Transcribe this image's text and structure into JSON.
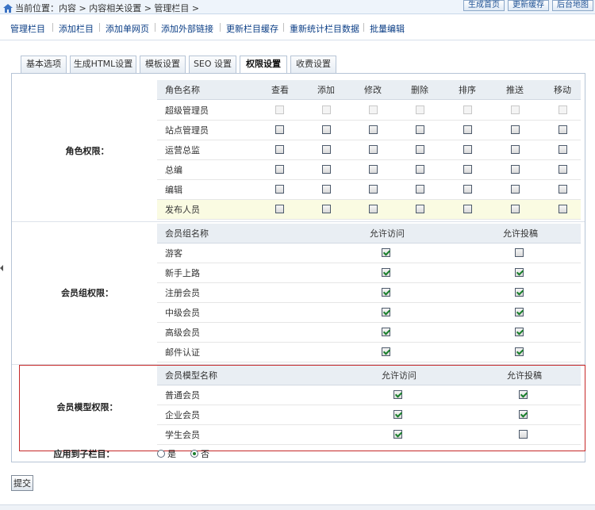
{
  "breadcrumb": {
    "text": "当前位置：内容 > 内容相关设置 > 管理栏目 >"
  },
  "top_buttons": [
    "生成首页",
    "更新缓存",
    "后台地图"
  ],
  "nav": [
    "管理栏目",
    "添加栏目",
    "添加单网页",
    "添加外部链接",
    "更新栏目缓存",
    "重新统计栏目数据",
    "批量编辑"
  ],
  "tabs": [
    "基本选项",
    "生成HTML设置",
    "模板设置",
    "SEO 设置",
    "权限设置",
    "收费设置"
  ],
  "active_tab": "权限设置",
  "role_section": {
    "label": "角色权限：",
    "headers": [
      "角色名称",
      "查看",
      "添加",
      "修改",
      "删除",
      "排序",
      "推送",
      "移动"
    ],
    "rows": [
      {
        "name": "超级管理员",
        "disabled": true
      },
      {
        "name": "站点管理员",
        "disabled": false
      },
      {
        "name": "运营总监",
        "disabled": false
      },
      {
        "name": "总编",
        "disabled": false
      },
      {
        "name": "编辑",
        "disabled": false
      },
      {
        "name": "发布人员",
        "disabled": false
      }
    ]
  },
  "group_section": {
    "label": "会员组权限：",
    "headers": [
      "会员组名称",
      "允许访问",
      "允许投稿"
    ],
    "rows": [
      {
        "name": "游客",
        "visit": true,
        "submit": false
      },
      {
        "name": "新手上路",
        "visit": true,
        "submit": true
      },
      {
        "name": "注册会员",
        "visit": true,
        "submit": true
      },
      {
        "name": "中级会员",
        "visit": true,
        "submit": true
      },
      {
        "name": "高级会员",
        "visit": true,
        "submit": true
      },
      {
        "name": "邮件认证",
        "visit": true,
        "submit": true
      }
    ]
  },
  "model_section": {
    "label": "会员模型权限：",
    "headers": [
      "会员模型名称",
      "允许访问",
      "允许投稿"
    ],
    "rows": [
      {
        "name": "普通会员",
        "visit": true,
        "submit": true
      },
      {
        "name": "企业会员",
        "visit": true,
        "submit": true
      },
      {
        "name": "学生会员",
        "visit": true,
        "submit": false
      }
    ]
  },
  "apply_children": {
    "label": "应用到子栏目：",
    "yes": "是",
    "no": "否",
    "selected": "no"
  },
  "submit_button": "提交",
  "colors": {
    "highlight_border": "#c62828",
    "link": "#0b3e86",
    "check": "#1a7f2c"
  }
}
